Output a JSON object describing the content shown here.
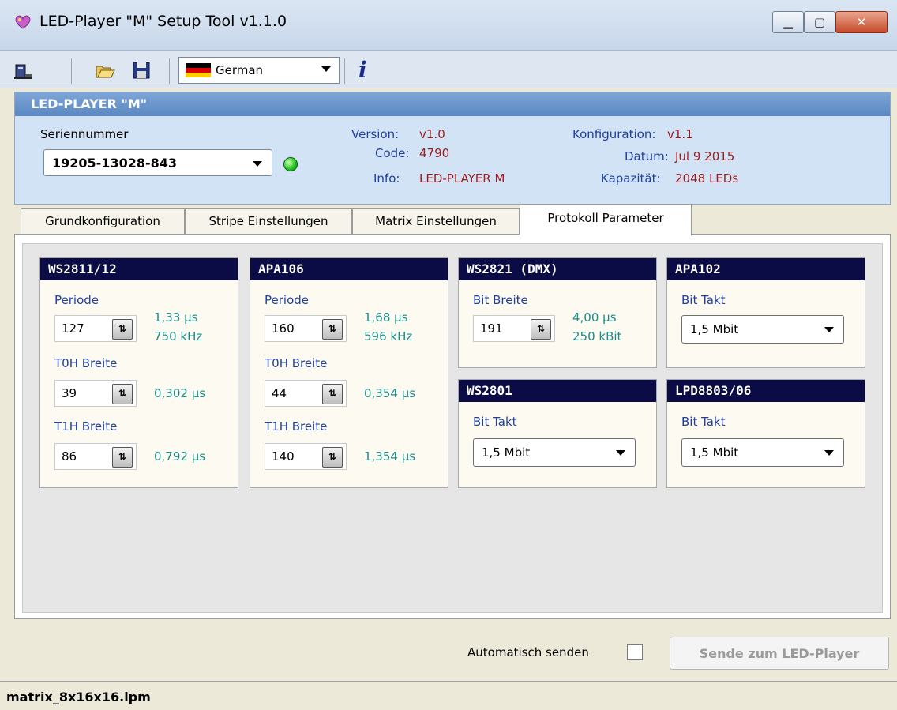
{
  "window": {
    "title": "LED-Player \"M\" Setup Tool v1.1.0",
    "icons": [
      "app-logo-icon",
      "minimize-icon",
      "maximize-icon",
      "close-icon"
    ]
  },
  "toolbar": {
    "language": "German",
    "icons": [
      "connect-icon",
      "open-folder-icon",
      "save-icon",
      "german-flag-icon",
      "info-icon"
    ]
  },
  "device": {
    "header": "LED-PLAYER \"M\"",
    "serial_label": "Seriennummer",
    "serial_value": "19205-13028-843",
    "status_color": "#1ec31e",
    "version_label": "Version:",
    "version_value": "v1.0",
    "code_label": "Code:",
    "code_value": "4790",
    "info_label": "Info:",
    "info_value": "LED-PLAYER M",
    "konfig_label": "Konfiguration:",
    "konfig_value": "v1.1",
    "datum_label": "Datum:",
    "datum_value": "Jul  9 2015",
    "kapazitaet_label": "Kapazität:",
    "kapazitaet_value": "2048 LEDs"
  },
  "tabs": [
    {
      "label": "Grundkonfiguration",
      "active": false
    },
    {
      "label": "Stripe Einstellungen",
      "active": false
    },
    {
      "label": "Matrix Einstellungen",
      "active": false
    },
    {
      "label": "Protokoll Parameter",
      "active": true
    }
  ],
  "groups": {
    "ws2811": {
      "title": "WS2811/12",
      "periode_label": "Periode",
      "periode_value": "127",
      "periode_info1": "1,33 µs",
      "periode_info2": "750 kHz",
      "t0h_label": "T0H Breite",
      "t0h_value": "39",
      "t0h_info": "0,302 µs",
      "t1h_label": "T1H Breite",
      "t1h_value": "86",
      "t1h_info": "0,792 µs"
    },
    "apa106": {
      "title": "APA106",
      "periode_label": "Periode",
      "periode_value": "160",
      "periode_info1": "1,68 µs",
      "periode_info2": "596 kHz",
      "t0h_label": "T0H Breite",
      "t0h_value": "44",
      "t0h_info": "0,354 µs",
      "t1h_label": "T1H Breite",
      "t1h_value": "140",
      "t1h_info": "1,354 µs"
    },
    "ws2821": {
      "title": "WS2821 (DMX)",
      "bit_label": "Bit Breite",
      "bit_value": "191",
      "bit_info1": "4,00 µs",
      "bit_info2": "250 kBit"
    },
    "apa102": {
      "title": "APA102",
      "takt_label": "Bit Takt",
      "takt_value": "1,5 Mbit"
    },
    "ws2801": {
      "title": "WS2801",
      "takt_label": "Bit Takt",
      "takt_value": "1,5 Mbit"
    },
    "lpd8803": {
      "title": "LPD8803/06",
      "takt_label": "Bit Takt",
      "takt_value": "1,5 Mbit"
    }
  },
  "footer": {
    "auto_send_label": "Automatisch senden",
    "auto_send_checked": false,
    "send_button": "Sende zum LED-Player"
  },
  "status": {
    "file": "matrix_8x16x16.lpm"
  }
}
